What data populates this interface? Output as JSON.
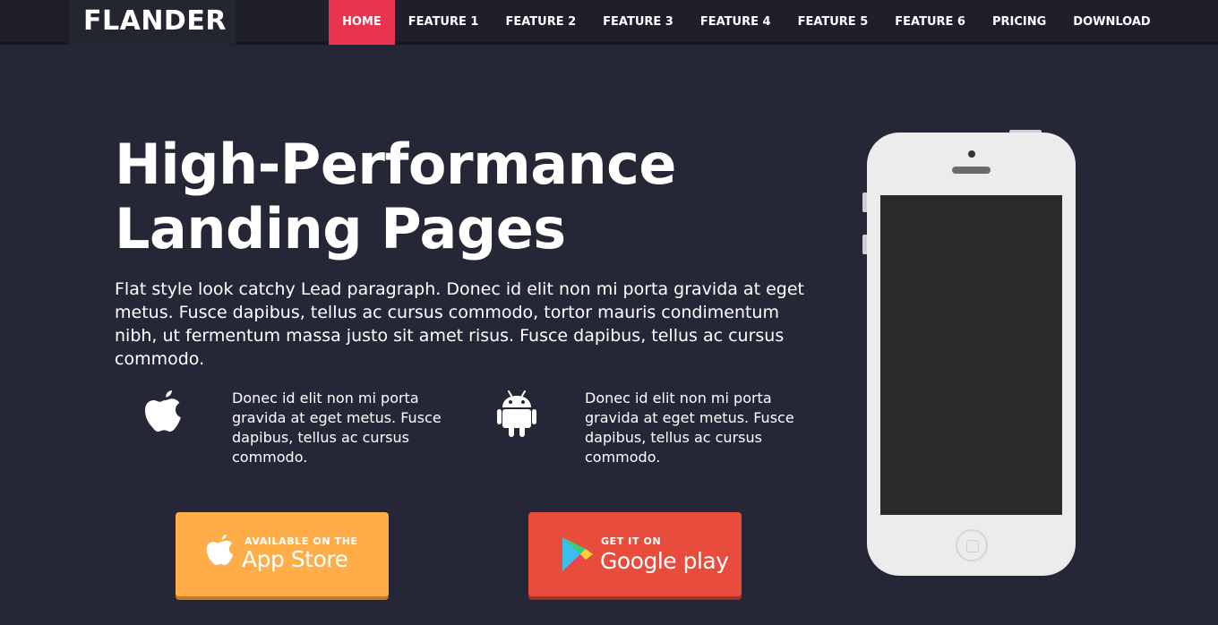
{
  "brand": {
    "name": "FLANDER"
  },
  "nav": {
    "items": [
      {
        "label": "HOME",
        "active": true
      },
      {
        "label": "FEATURE 1",
        "active": false
      },
      {
        "label": "FEATURE 2",
        "active": false
      },
      {
        "label": "FEATURE 3",
        "active": false
      },
      {
        "label": "FEATURE 4",
        "active": false
      },
      {
        "label": "FEATURE 5",
        "active": false
      },
      {
        "label": "FEATURE 6",
        "active": false
      },
      {
        "label": "PRICING",
        "active": false
      },
      {
        "label": "DOWNLOAD",
        "active": false
      }
    ]
  },
  "hero": {
    "headline_line1": "High-Performance",
    "headline_line2": "Landing Pages",
    "lead": "Flat style look catchy Lead paragraph. Donec id elit non mi porta gravida at eget metus. Fusce dapibus, tellus ac cursus commodo, tortor mauris condimentum nibh, ut fermentum massa justo sit amet risus. Fusce dapibus, tellus ac cursus commodo."
  },
  "features": [
    {
      "icon": "apple-icon",
      "text": "Donec id elit non mi porta gravida at eget metus. Fusce dapibus, tellus ac cursus commodo."
    },
    {
      "icon": "android-icon",
      "text": "Donec id elit non mi porta gravida at eget metus. Fusce dapibus, tellus ac cursus commodo."
    }
  ],
  "buttons": {
    "appstore": {
      "small": "AVAILABLE ON THE",
      "big": "App Store",
      "icon": "apple-icon"
    },
    "googleplay": {
      "small": "GET IT ON",
      "big": "Google play",
      "icon": "google-play-icon"
    }
  },
  "colors": {
    "background": "#252736",
    "navbar": "#1e1f2a",
    "nav_active": "#e8344e",
    "appstore_button": "#fead48",
    "googleplay_button": "#e74c3c",
    "phone_body": "#ececec",
    "phone_screen": "#2a2a2a"
  }
}
